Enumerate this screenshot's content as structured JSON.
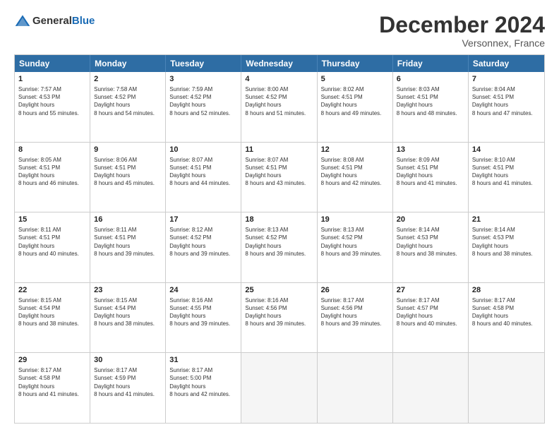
{
  "header": {
    "logo_general": "General",
    "logo_blue": "Blue",
    "title": "December 2024",
    "location": "Versonnex, France"
  },
  "calendar": {
    "days_of_week": [
      "Sunday",
      "Monday",
      "Tuesday",
      "Wednesday",
      "Thursday",
      "Friday",
      "Saturday"
    ],
    "weeks": [
      [
        {
          "day": "1",
          "sunrise": "7:57 AM",
          "sunset": "4:53 PM",
          "daylight": "8 hours and 55 minutes."
        },
        {
          "day": "2",
          "sunrise": "7:58 AM",
          "sunset": "4:52 PM",
          "daylight": "8 hours and 54 minutes."
        },
        {
          "day": "3",
          "sunrise": "7:59 AM",
          "sunset": "4:52 PM",
          "daylight": "8 hours and 52 minutes."
        },
        {
          "day": "4",
          "sunrise": "8:00 AM",
          "sunset": "4:52 PM",
          "daylight": "8 hours and 51 minutes."
        },
        {
          "day": "5",
          "sunrise": "8:02 AM",
          "sunset": "4:51 PM",
          "daylight": "8 hours and 49 minutes."
        },
        {
          "day": "6",
          "sunrise": "8:03 AM",
          "sunset": "4:51 PM",
          "daylight": "8 hours and 48 minutes."
        },
        {
          "day": "7",
          "sunrise": "8:04 AM",
          "sunset": "4:51 PM",
          "daylight": "8 hours and 47 minutes."
        }
      ],
      [
        {
          "day": "8",
          "sunrise": "8:05 AM",
          "sunset": "4:51 PM",
          "daylight": "8 hours and 46 minutes."
        },
        {
          "day": "9",
          "sunrise": "8:06 AM",
          "sunset": "4:51 PM",
          "daylight": "8 hours and 45 minutes."
        },
        {
          "day": "10",
          "sunrise": "8:07 AM",
          "sunset": "4:51 PM",
          "daylight": "8 hours and 44 minutes."
        },
        {
          "day": "11",
          "sunrise": "8:07 AM",
          "sunset": "4:51 PM",
          "daylight": "8 hours and 43 minutes."
        },
        {
          "day": "12",
          "sunrise": "8:08 AM",
          "sunset": "4:51 PM",
          "daylight": "8 hours and 42 minutes."
        },
        {
          "day": "13",
          "sunrise": "8:09 AM",
          "sunset": "4:51 PM",
          "daylight": "8 hours and 41 minutes."
        },
        {
          "day": "14",
          "sunrise": "8:10 AM",
          "sunset": "4:51 PM",
          "daylight": "8 hours and 41 minutes."
        }
      ],
      [
        {
          "day": "15",
          "sunrise": "8:11 AM",
          "sunset": "4:51 PM",
          "daylight": "8 hours and 40 minutes."
        },
        {
          "day": "16",
          "sunrise": "8:11 AM",
          "sunset": "4:51 PM",
          "daylight": "8 hours and 39 minutes."
        },
        {
          "day": "17",
          "sunrise": "8:12 AM",
          "sunset": "4:52 PM",
          "daylight": "8 hours and 39 minutes."
        },
        {
          "day": "18",
          "sunrise": "8:13 AM",
          "sunset": "4:52 PM",
          "daylight": "8 hours and 39 minutes."
        },
        {
          "day": "19",
          "sunrise": "8:13 AM",
          "sunset": "4:52 PM",
          "daylight": "8 hours and 39 minutes."
        },
        {
          "day": "20",
          "sunrise": "8:14 AM",
          "sunset": "4:53 PM",
          "daylight": "8 hours and 38 minutes."
        },
        {
          "day": "21",
          "sunrise": "8:14 AM",
          "sunset": "4:53 PM",
          "daylight": "8 hours and 38 minutes."
        }
      ],
      [
        {
          "day": "22",
          "sunrise": "8:15 AM",
          "sunset": "4:54 PM",
          "daylight": "8 hours and 38 minutes."
        },
        {
          "day": "23",
          "sunrise": "8:15 AM",
          "sunset": "4:54 PM",
          "daylight": "8 hours and 38 minutes."
        },
        {
          "day": "24",
          "sunrise": "8:16 AM",
          "sunset": "4:55 PM",
          "daylight": "8 hours and 39 minutes."
        },
        {
          "day": "25",
          "sunrise": "8:16 AM",
          "sunset": "4:56 PM",
          "daylight": "8 hours and 39 minutes."
        },
        {
          "day": "26",
          "sunrise": "8:17 AM",
          "sunset": "4:56 PM",
          "daylight": "8 hours and 39 minutes."
        },
        {
          "day": "27",
          "sunrise": "8:17 AM",
          "sunset": "4:57 PM",
          "daylight": "8 hours and 40 minutes."
        },
        {
          "day": "28",
          "sunrise": "8:17 AM",
          "sunset": "4:58 PM",
          "daylight": "8 hours and 40 minutes."
        }
      ],
      [
        {
          "day": "29",
          "sunrise": "8:17 AM",
          "sunset": "4:58 PM",
          "daylight": "8 hours and 41 minutes."
        },
        {
          "day": "30",
          "sunrise": "8:17 AM",
          "sunset": "4:59 PM",
          "daylight": "8 hours and 41 minutes."
        },
        {
          "day": "31",
          "sunrise": "8:17 AM",
          "sunset": "5:00 PM",
          "daylight": "8 hours and 42 minutes."
        },
        null,
        null,
        null,
        null
      ]
    ]
  }
}
